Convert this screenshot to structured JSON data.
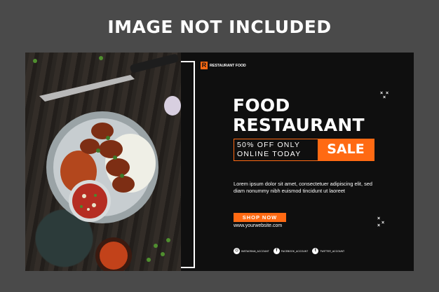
{
  "watermark": "IMAGE NOT INCLUDED",
  "brand": {
    "mark": "R",
    "name": "RESTAURANT FOOD"
  },
  "headline": {
    "line1": "FOOD",
    "line2": "RESTAURANT"
  },
  "offer": {
    "line1": "50% OFF ONLY",
    "line2": "ONLINE TODAY",
    "badge": "SALE"
  },
  "body_text": "Lorem ipsum dolor sit amet, consectetuer adipiscing elit, sed diam nonummy nibh euismod tincidunt ut laoreet",
  "cta": {
    "label": "SHOP NOW",
    "website": "www.yourwebsite.com"
  },
  "socials": [
    {
      "icon": "instagram-icon",
      "glyph": "◎",
      "label": "INSTAGRAM_ACCOUNT"
    },
    {
      "icon": "facebook-icon",
      "glyph": "f",
      "label": "FACEBOOK_ACCOUNT"
    },
    {
      "icon": "twitter-icon",
      "glyph": "t",
      "label": "TWITTER_ACCOUNT"
    }
  ],
  "colors": {
    "accent": "#ff6a13",
    "panel": "#0f0f0f",
    "background": "#4a4a4a",
    "text": "#ffffff"
  }
}
